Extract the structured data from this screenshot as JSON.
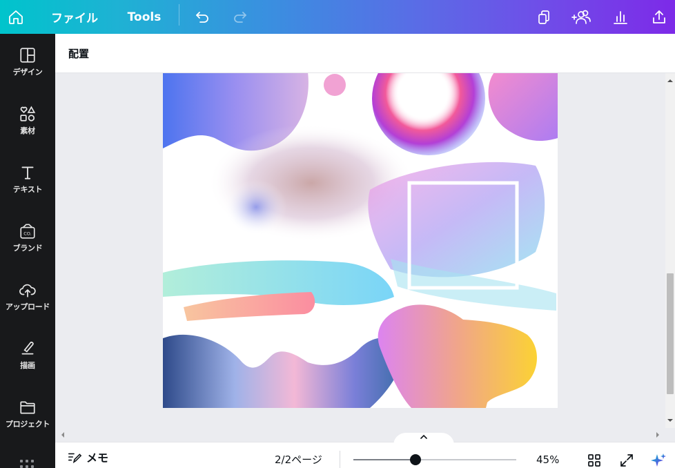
{
  "topbar": {
    "home_icon": "home-icon",
    "file_label": "ファイル",
    "tools_label": "Tools",
    "undo_icon": "undo-icon",
    "redo_icon": "redo-icon",
    "right_icons": [
      "copy-icon",
      "share-people-icon",
      "insights-icon",
      "upload-share-icon"
    ]
  },
  "sidebar": {
    "items": [
      {
        "label": "デザイン",
        "icon": "layout-icon"
      },
      {
        "label": "素材",
        "icon": "shapes-icon"
      },
      {
        "label": "テキスト",
        "icon": "text-icon"
      },
      {
        "label": "ブランド",
        "icon": "brand-icon"
      },
      {
        "label": "アップロード",
        "icon": "cloud-upload-icon"
      },
      {
        "label": "描画",
        "icon": "draw-icon"
      },
      {
        "label": "プロジェクト",
        "icon": "folder-icon"
      }
    ],
    "more_icon": "more-apps-icon"
  },
  "subheader": {
    "title": "配置"
  },
  "bottombar": {
    "notes_label": "メモ",
    "page_indicator": "2/2ページ",
    "zoom_label": "45%",
    "zoom_value": 0.38,
    "icons": [
      "grid-view-icon",
      "fullscreen-icon",
      "magic-sparkle-icon"
    ]
  },
  "colors": {
    "topbar_start": "#00c4cc",
    "topbar_end": "#7d2ae8",
    "sidebar_bg": "#18191b",
    "canvas_bg": "#ebecf0"
  }
}
